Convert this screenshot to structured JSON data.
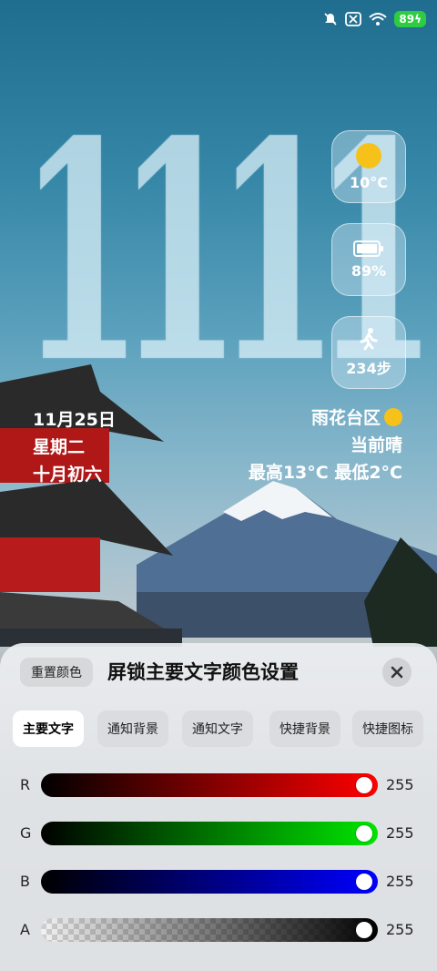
{
  "status_bar": {
    "battery": "89"
  },
  "clock": {
    "time": "1111"
  },
  "widgets": {
    "weather_temp": "10°C",
    "battery_pct": "89%",
    "steps": "234步"
  },
  "date": {
    "date": "11月25日",
    "weekday": "星期二",
    "lunar": "十月初六"
  },
  "weather": {
    "location": "雨花台区",
    "condition": "当前晴",
    "range": "最高13°C 最低2°C"
  },
  "panel": {
    "reset_label": "重置颜色",
    "title": "屏锁主要文字颜色设置",
    "tabs": [
      "主要文字",
      "通知背景",
      "通知文字",
      "快捷背景",
      "快捷图标"
    ],
    "active_tab": "主要文字",
    "sliders": [
      {
        "label": "R",
        "value": "255",
        "level": 1.0
      },
      {
        "label": "G",
        "value": "255",
        "level": 1.0
      },
      {
        "label": "B",
        "value": "255",
        "level": 1.0
      },
      {
        "label": "A",
        "value": "255",
        "level": 1.0
      }
    ]
  },
  "colors": {
    "accent_red": "#ff0000",
    "accent_green": "#00e000",
    "accent_blue": "#0000ff",
    "battery_green": "#2ecc40"
  }
}
